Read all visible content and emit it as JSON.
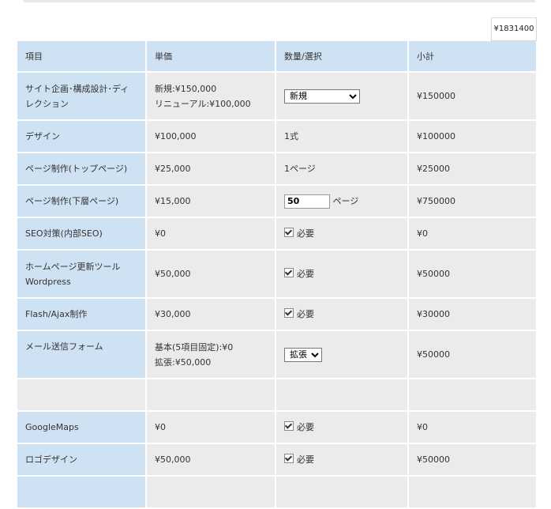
{
  "total": "¥1831400",
  "headers": [
    "項目",
    "単価",
    "数量/選択",
    "小計"
  ],
  "rows": [
    {
      "item": "サイト企画･構成設計･ディレクション",
      "price_lines": [
        "新規:¥150,000",
        "リニューアル:¥100,000"
      ],
      "qty_type": "select",
      "qty_value": "新規",
      "subtotal": "¥150000"
    },
    {
      "item": "デザイン",
      "price_lines": [
        "¥100,000"
      ],
      "qty_type": "text",
      "qty_value": "1式",
      "subtotal": "¥100000"
    },
    {
      "item": "ページ制作(トップページ)",
      "price_lines": [
        "¥25,000"
      ],
      "qty_type": "text",
      "qty_value": "1ページ",
      "subtotal": "¥25000"
    },
    {
      "item": "ページ制作(下層ページ)",
      "price_lines": [
        "¥15,000"
      ],
      "qty_type": "input",
      "qty_value": "50",
      "qty_suffix": "ページ",
      "subtotal": "¥750000"
    },
    {
      "item": "SEO対策(内部SEO)",
      "price_lines": [
        "¥0"
      ],
      "qty_type": "checkbox",
      "qty_value": "必要",
      "subtotal": "¥0"
    },
    {
      "item": "ホームページ更新ツールWordpress",
      "price_lines": [
        "¥50,000"
      ],
      "qty_type": "checkbox",
      "qty_value": "必要",
      "subtotal": "¥50000"
    },
    {
      "item": "Flash/Ajax制作",
      "price_lines": [
        "¥30,000"
      ],
      "qty_type": "checkbox",
      "qty_value": "必要",
      "subtotal": "¥30000"
    },
    {
      "item": "メール送信フォーム",
      "price_lines": [
        "基本(5項目固定):¥0",
        "拡張:¥50,000"
      ],
      "qty_type": "select",
      "qty_value": "拡張",
      "subtotal": "¥50000"
    },
    {
      "item": "",
      "price_lines": [],
      "qty_type": "none",
      "qty_value": "",
      "subtotal": ""
    },
    {
      "item": "GoogleMaps",
      "price_lines": [
        "¥0"
      ],
      "qty_type": "checkbox",
      "qty_value": "必要",
      "subtotal": "¥0"
    },
    {
      "item": "ロゴデザイン",
      "price_lines": [
        "¥50,000"
      ],
      "qty_type": "checkbox",
      "qty_value": "必要",
      "subtotal": "¥50000"
    },
    {
      "item": "",
      "price_lines": [],
      "qty_type": "none",
      "qty_value": "",
      "subtotal": ""
    }
  ]
}
